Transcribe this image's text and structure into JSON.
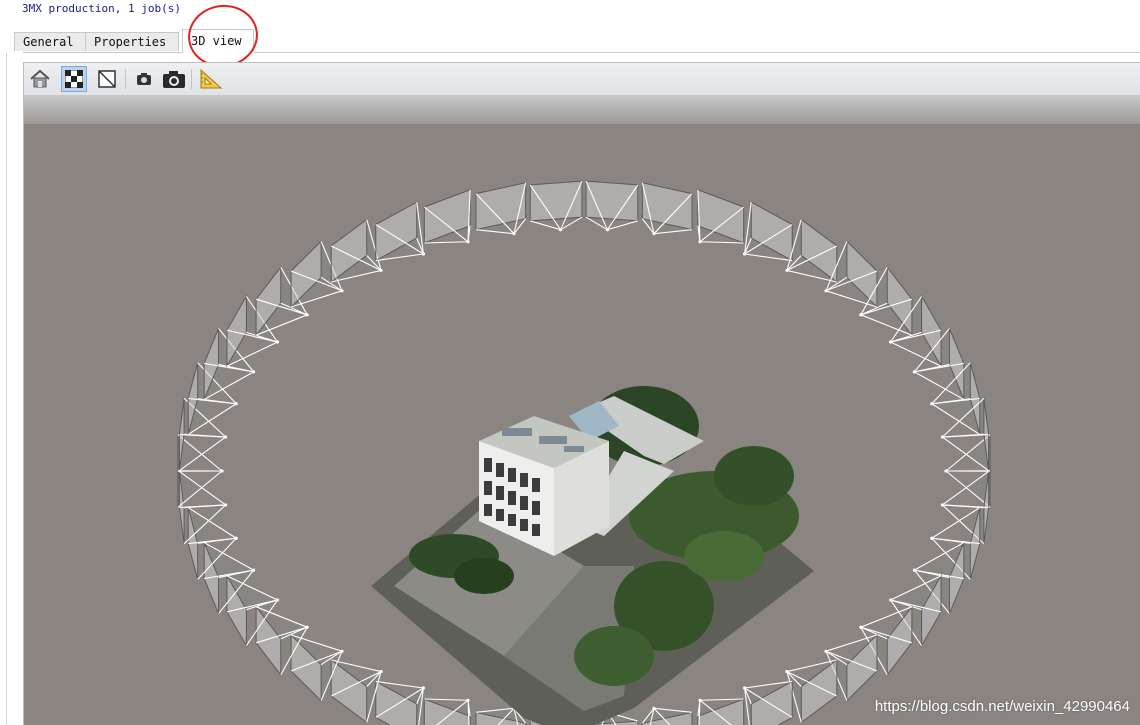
{
  "header": {
    "status_text": "3MX production, 1 job(s)"
  },
  "tabs": [
    {
      "label": "General",
      "active": false
    },
    {
      "label": "Properties",
      "active": false
    },
    {
      "label": "3D view",
      "active": true
    }
  ],
  "toolbar": {
    "buttons": [
      {
        "name": "home-icon",
        "active": false
      },
      {
        "name": "checkerboard-icon",
        "active": true
      },
      {
        "name": "wireframe-icon",
        "active": false
      },
      {
        "name": "camera-small-icon",
        "active": false
      },
      {
        "name": "camera-large-icon",
        "active": false
      },
      {
        "name": "set-square-icon",
        "active": false
      }
    ]
  },
  "viewport": {
    "background_color": "#8a8580",
    "scene": "photogrammetry model of a building surrounded by a ring of camera frustums"
  },
  "watermark": "https://blog.csdn.net/weixin_42990464",
  "colors": {
    "annotation": "#e3221d",
    "header_text": "#1a1a8c",
    "active_tool": "#b9d3ef"
  }
}
